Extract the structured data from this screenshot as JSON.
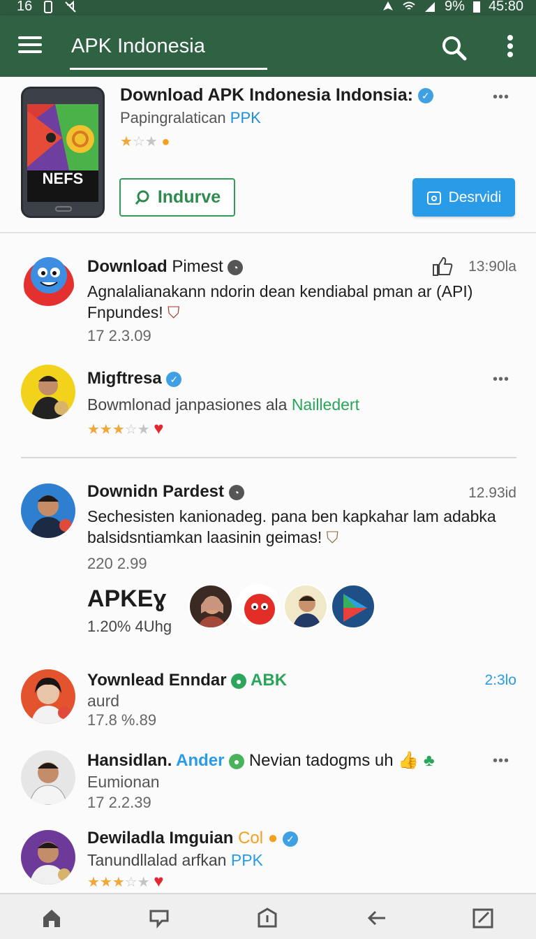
{
  "status_bar": {
    "time_left": "16",
    "battery": "9%",
    "clock": "45:80"
  },
  "app_bar": {
    "title": "APK Indonesia",
    "menu_icon": "hamburger-icon",
    "search_icon": "search-icon",
    "more_icon": "more-vert-icon"
  },
  "hero": {
    "title": "Download APK Indonesia Indonsia:",
    "subtitle_plain": "Papingralatican ",
    "subtitle_link": "PPK",
    "screen_text": "NEFS",
    "rating": 1,
    "rating_max": 3,
    "install_label": "Indurve",
    "download_label": "Desrvidi",
    "more": "•••"
  },
  "items": [
    {
      "name_bold": "Download",
      "name_rest": " Pimest",
      "time": "13:90la",
      "text": "Agnalalianakann ndorin dean kendiabal pman ar (API) Fnpundes!",
      "meta": "17 2.3.09"
    },
    {
      "name": "Migftresa",
      "text_plain": "Bowmlonad janpasiones ala ",
      "text_link": "Nailledert",
      "rating": 3,
      "rating_max": 5,
      "more": "•••"
    },
    {
      "name": "Downidn Pardest",
      "time": "12.93id",
      "text": "Sechesisten kanionadeg. pana ben kapkahar lam adabka balsidsntiamkan laasinin geimas!",
      "meta": "220 2.99"
    },
    {
      "title": "APKEɣ",
      "sub": "1.20% 4Uhg"
    },
    {
      "name": "Yownlead Enndar",
      "tag": "ABK",
      "time": "2:3lo",
      "text": "aurd",
      "meta": "17.8 %.89"
    },
    {
      "name": "Hansidlan.",
      "name_link": "Ander",
      "name_rest": "Nevian tadogms uh",
      "text": "Eumionan",
      "meta": "17 2.2.39",
      "more": "•••"
    },
    {
      "name": "Dewiladla Imguian",
      "tag": "Col",
      "text_plain": "Tanundllalad arfkan ",
      "text_link": "PPK",
      "rating": 3,
      "rating_max": 5
    }
  ],
  "bottom_nav": [
    "home-icon",
    "chat-icon",
    "info-icon",
    "back-icon",
    "edit-icon"
  ]
}
